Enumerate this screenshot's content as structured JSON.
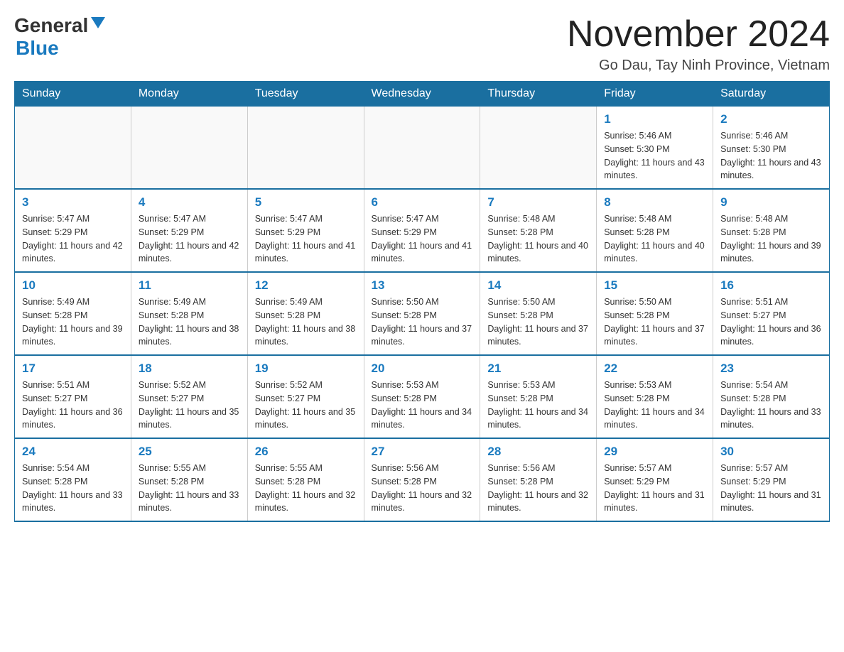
{
  "header": {
    "logo": {
      "general": "General",
      "blue": "Blue",
      "alt": "GeneralBlue logo"
    },
    "title": "November 2024",
    "location": "Go Dau, Tay Ninh Province, Vietnam"
  },
  "calendar": {
    "days_of_week": [
      "Sunday",
      "Monday",
      "Tuesday",
      "Wednesday",
      "Thursday",
      "Friday",
      "Saturday"
    ],
    "weeks": [
      [
        {
          "day": "",
          "info": ""
        },
        {
          "day": "",
          "info": ""
        },
        {
          "day": "",
          "info": ""
        },
        {
          "day": "",
          "info": ""
        },
        {
          "day": "",
          "info": ""
        },
        {
          "day": "1",
          "info": "Sunrise: 5:46 AM\nSunset: 5:30 PM\nDaylight: 11 hours and 43 minutes."
        },
        {
          "day": "2",
          "info": "Sunrise: 5:46 AM\nSunset: 5:30 PM\nDaylight: 11 hours and 43 minutes."
        }
      ],
      [
        {
          "day": "3",
          "info": "Sunrise: 5:47 AM\nSunset: 5:29 PM\nDaylight: 11 hours and 42 minutes."
        },
        {
          "day": "4",
          "info": "Sunrise: 5:47 AM\nSunset: 5:29 PM\nDaylight: 11 hours and 42 minutes."
        },
        {
          "day": "5",
          "info": "Sunrise: 5:47 AM\nSunset: 5:29 PM\nDaylight: 11 hours and 41 minutes."
        },
        {
          "day": "6",
          "info": "Sunrise: 5:47 AM\nSunset: 5:29 PM\nDaylight: 11 hours and 41 minutes."
        },
        {
          "day": "7",
          "info": "Sunrise: 5:48 AM\nSunset: 5:28 PM\nDaylight: 11 hours and 40 minutes."
        },
        {
          "day": "8",
          "info": "Sunrise: 5:48 AM\nSunset: 5:28 PM\nDaylight: 11 hours and 40 minutes."
        },
        {
          "day": "9",
          "info": "Sunrise: 5:48 AM\nSunset: 5:28 PM\nDaylight: 11 hours and 39 minutes."
        }
      ],
      [
        {
          "day": "10",
          "info": "Sunrise: 5:49 AM\nSunset: 5:28 PM\nDaylight: 11 hours and 39 minutes."
        },
        {
          "day": "11",
          "info": "Sunrise: 5:49 AM\nSunset: 5:28 PM\nDaylight: 11 hours and 38 minutes."
        },
        {
          "day": "12",
          "info": "Sunrise: 5:49 AM\nSunset: 5:28 PM\nDaylight: 11 hours and 38 minutes."
        },
        {
          "day": "13",
          "info": "Sunrise: 5:50 AM\nSunset: 5:28 PM\nDaylight: 11 hours and 37 minutes."
        },
        {
          "day": "14",
          "info": "Sunrise: 5:50 AM\nSunset: 5:28 PM\nDaylight: 11 hours and 37 minutes."
        },
        {
          "day": "15",
          "info": "Sunrise: 5:50 AM\nSunset: 5:28 PM\nDaylight: 11 hours and 37 minutes."
        },
        {
          "day": "16",
          "info": "Sunrise: 5:51 AM\nSunset: 5:27 PM\nDaylight: 11 hours and 36 minutes."
        }
      ],
      [
        {
          "day": "17",
          "info": "Sunrise: 5:51 AM\nSunset: 5:27 PM\nDaylight: 11 hours and 36 minutes."
        },
        {
          "day": "18",
          "info": "Sunrise: 5:52 AM\nSunset: 5:27 PM\nDaylight: 11 hours and 35 minutes."
        },
        {
          "day": "19",
          "info": "Sunrise: 5:52 AM\nSunset: 5:27 PM\nDaylight: 11 hours and 35 minutes."
        },
        {
          "day": "20",
          "info": "Sunrise: 5:53 AM\nSunset: 5:28 PM\nDaylight: 11 hours and 34 minutes."
        },
        {
          "day": "21",
          "info": "Sunrise: 5:53 AM\nSunset: 5:28 PM\nDaylight: 11 hours and 34 minutes."
        },
        {
          "day": "22",
          "info": "Sunrise: 5:53 AM\nSunset: 5:28 PM\nDaylight: 11 hours and 34 minutes."
        },
        {
          "day": "23",
          "info": "Sunrise: 5:54 AM\nSunset: 5:28 PM\nDaylight: 11 hours and 33 minutes."
        }
      ],
      [
        {
          "day": "24",
          "info": "Sunrise: 5:54 AM\nSunset: 5:28 PM\nDaylight: 11 hours and 33 minutes."
        },
        {
          "day": "25",
          "info": "Sunrise: 5:55 AM\nSunset: 5:28 PM\nDaylight: 11 hours and 33 minutes."
        },
        {
          "day": "26",
          "info": "Sunrise: 5:55 AM\nSunset: 5:28 PM\nDaylight: 11 hours and 32 minutes."
        },
        {
          "day": "27",
          "info": "Sunrise: 5:56 AM\nSunset: 5:28 PM\nDaylight: 11 hours and 32 minutes."
        },
        {
          "day": "28",
          "info": "Sunrise: 5:56 AM\nSunset: 5:28 PM\nDaylight: 11 hours and 32 minutes."
        },
        {
          "day": "29",
          "info": "Sunrise: 5:57 AM\nSunset: 5:29 PM\nDaylight: 11 hours and 31 minutes."
        },
        {
          "day": "30",
          "info": "Sunrise: 5:57 AM\nSunset: 5:29 PM\nDaylight: 11 hours and 31 minutes."
        }
      ]
    ]
  }
}
